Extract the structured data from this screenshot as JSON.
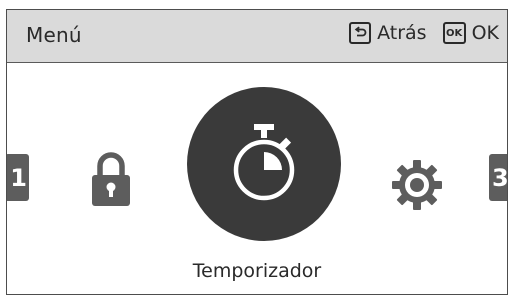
{
  "header": {
    "title": "Menú",
    "back_label": "Atrás",
    "ok_icon_text": "OK",
    "ok_label": "OK"
  },
  "carousel": {
    "left_tile_label": "1",
    "right_tile_label": "3",
    "items": [
      {
        "name": "lock",
        "icon": "lock-icon"
      },
      {
        "name": "Temporizador",
        "icon": "stopwatch-icon",
        "selected": true
      },
      {
        "name": "settings",
        "icon": "gear-icon"
      }
    ],
    "selected_label": "Temporizador"
  },
  "colors": {
    "header_bg": "#dadada",
    "icon_gray": "#5d5d5d",
    "selected_circle": "#3a3a3a",
    "text": "#2a2a2a"
  }
}
